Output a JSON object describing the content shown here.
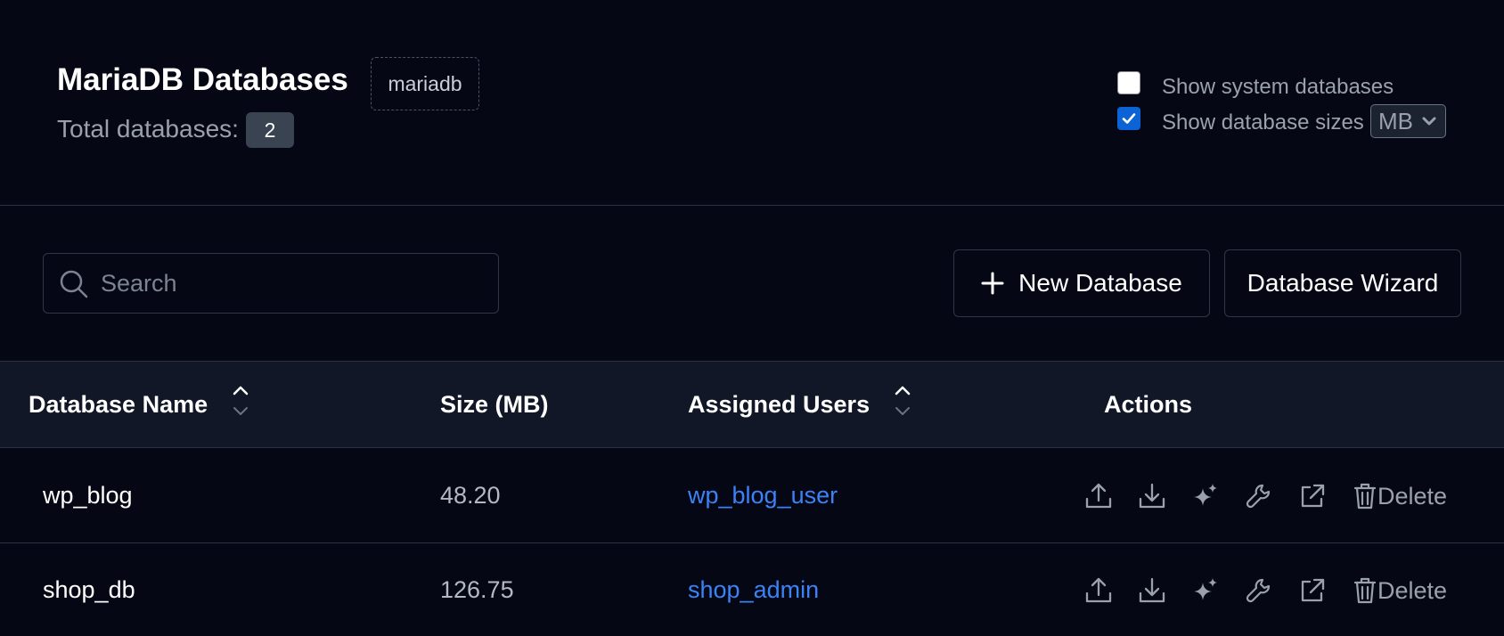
{
  "header": {
    "title": "MariaDB Databases",
    "engine_badge": "mariadb",
    "total_label": "Total databases:",
    "total_count": "2"
  },
  "options": {
    "show_system": {
      "label": "Show system databases",
      "checked": false
    },
    "show_sizes": {
      "label": "Show database sizes",
      "checked": true
    },
    "size_unit": "MB"
  },
  "toolbar": {
    "search_placeholder": "Search",
    "new_database_label": "New Database",
    "wizard_label": "Database Wizard"
  },
  "table": {
    "columns": [
      "Database Name",
      "Size (MB)",
      "Assigned Users",
      "Actions"
    ],
    "rows": [
      {
        "name": "wp_blog",
        "size": "48.20",
        "user": "wp_blog_user"
      },
      {
        "name": "shop_db",
        "size": "126.75",
        "user": "shop_admin"
      }
    ],
    "delete_label": "Delete"
  },
  "colors": {
    "background": "#050814",
    "header_row": "#111726",
    "link": "#3b82f6",
    "checkbox_accent": "#0b63d6"
  }
}
